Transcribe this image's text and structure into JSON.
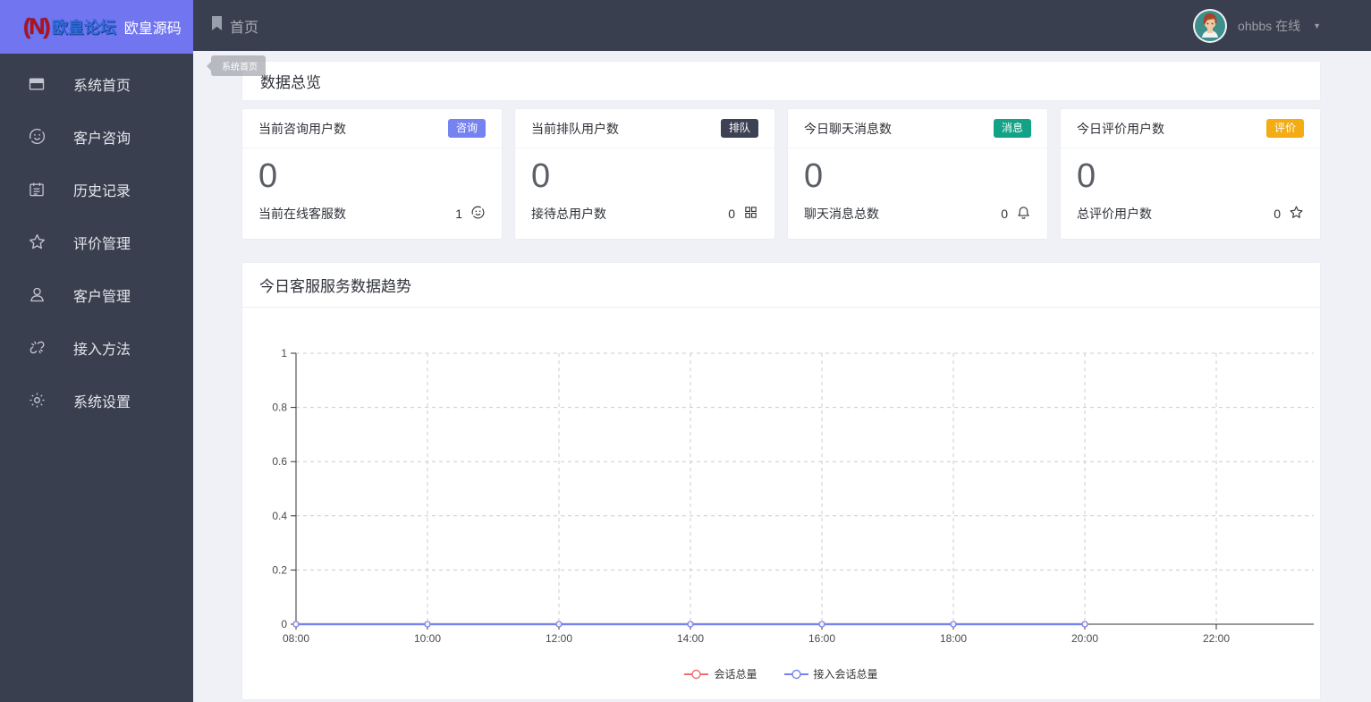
{
  "brand": {
    "logo_mark": "(N)",
    "forum_text": "欧皇论坛",
    "site_text": "欧皇源码",
    "bg_color": "#7175f0"
  },
  "navbar": {
    "home_label": "首页",
    "user_label": "ohbbs 在线",
    "caret": "▼"
  },
  "sidebar": {
    "items": [
      {
        "icon": "window-icon",
        "label": "系统首页"
      },
      {
        "icon": "smiley-icon",
        "label": "客户咨询"
      },
      {
        "icon": "notebook-icon",
        "label": "历史记录"
      },
      {
        "icon": "star-icon",
        "label": "评价管理"
      },
      {
        "icon": "user-icon",
        "label": "客户管理"
      },
      {
        "icon": "link-icon",
        "label": "接入方法"
      },
      {
        "icon": "gear-icon",
        "label": "系统设置"
      }
    ]
  },
  "content": {
    "tab_tag": "系统首页",
    "overview_title": "数据总览",
    "stat_cards": [
      {
        "title": "当前咨询用户数",
        "badge": "咨询",
        "badge_color": "#7583f0",
        "value": "0",
        "footer_label": "当前在线客服数",
        "footer_value": "1",
        "footer_icon": "smiley-icon"
      },
      {
        "title": "当前排队用户数",
        "badge": "排队",
        "badge_color": "#3c4154",
        "value": "0",
        "footer_label": "接待总用户数",
        "footer_value": "0",
        "footer_icon": "team-icon"
      },
      {
        "title": "今日聊天消息数",
        "badge": "消息",
        "badge_color": "#13a286",
        "value": "0",
        "footer_label": "聊天消息总数",
        "footer_value": "0",
        "footer_icon": "bell-icon"
      },
      {
        "title": "今日评价用户数",
        "badge": "评价",
        "badge_color": "#f3ac13",
        "value": "0",
        "footer_label": "总评价用户数",
        "footer_value": "0",
        "footer_icon": "star-icon"
      }
    ],
    "chart_title": "今日客服服务数据趋势"
  },
  "chart_data": {
    "type": "line",
    "title": "今日客服服务数据趋势",
    "x": [
      "08:00",
      "10:00",
      "12:00",
      "14:00",
      "16:00",
      "18:00",
      "20:00",
      "22:00"
    ],
    "series": [
      {
        "name": "会话总量",
        "color": "#f56c6c",
        "values": [
          0,
          0,
          0,
          0,
          0,
          0,
          0
        ]
      },
      {
        "name": "接入会话总量",
        "color": "#7583f0",
        "values": [
          0,
          0,
          0,
          0,
          0,
          0,
          0
        ]
      }
    ],
    "ylim": [
      0,
      1
    ],
    "yticks": [
      0,
      0.2,
      0.4,
      0.6,
      0.8,
      1
    ],
    "xlabel": "",
    "ylabel": "",
    "grid": "dashed",
    "legend_position": "bottom"
  }
}
